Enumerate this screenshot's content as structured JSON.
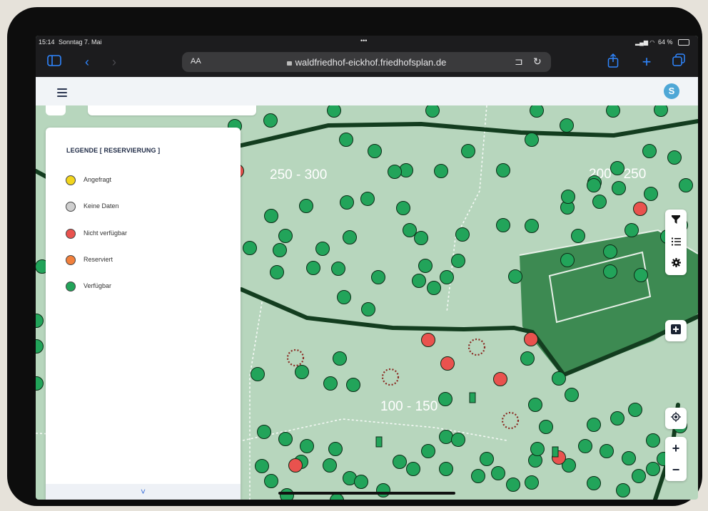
{
  "status_bar": {
    "time": "15:14",
    "date": "Sonntag 7. Mai",
    "dots": "•••",
    "battery": "64 %"
  },
  "browser": {
    "text_size_label": "AA",
    "url": "waldfriedhof-eickhof.friedhofsplan.de",
    "icons": [
      "sidebar-icon",
      "back-icon",
      "forward-icon",
      "reader-icon",
      "reload-icon",
      "share-icon",
      "new-tab-icon",
      "tabs-icon"
    ]
  },
  "app": {
    "avatar_letter": "S"
  },
  "legend": {
    "title": "LEGENDE [ RESERVIERUNG ]",
    "items": [
      {
        "label": "Angefragt",
        "color": "#f2d51d"
      },
      {
        "label": "Keine Daten",
        "color": "#cfcfcf"
      },
      {
        "label": "Nicht verfügbar",
        "color": "#e9524e"
      },
      {
        "label": "Reserviert",
        "color": "#f2803c"
      },
      {
        "label": "Verfügbar",
        "color": "#22a45a"
      }
    ],
    "collapse_icon": "˅"
  },
  "map": {
    "area_labels": [
      "250 - 300",
      "200 - 250",
      "100 - 150"
    ],
    "colors": {
      "background": "#b7d6bd",
      "path": "#133d1f",
      "field": "#3d8a52",
      "available": "#22a45a",
      "unavailable": "#e9524e"
    }
  },
  "tools": [
    "filter-icon",
    "list-icon",
    "settings-icon",
    "add-icon",
    "locate-icon",
    "zoom-in-icon",
    "zoom-out-icon"
  ],
  "zoom": {
    "in_label": "+",
    "out_label": "−"
  }
}
